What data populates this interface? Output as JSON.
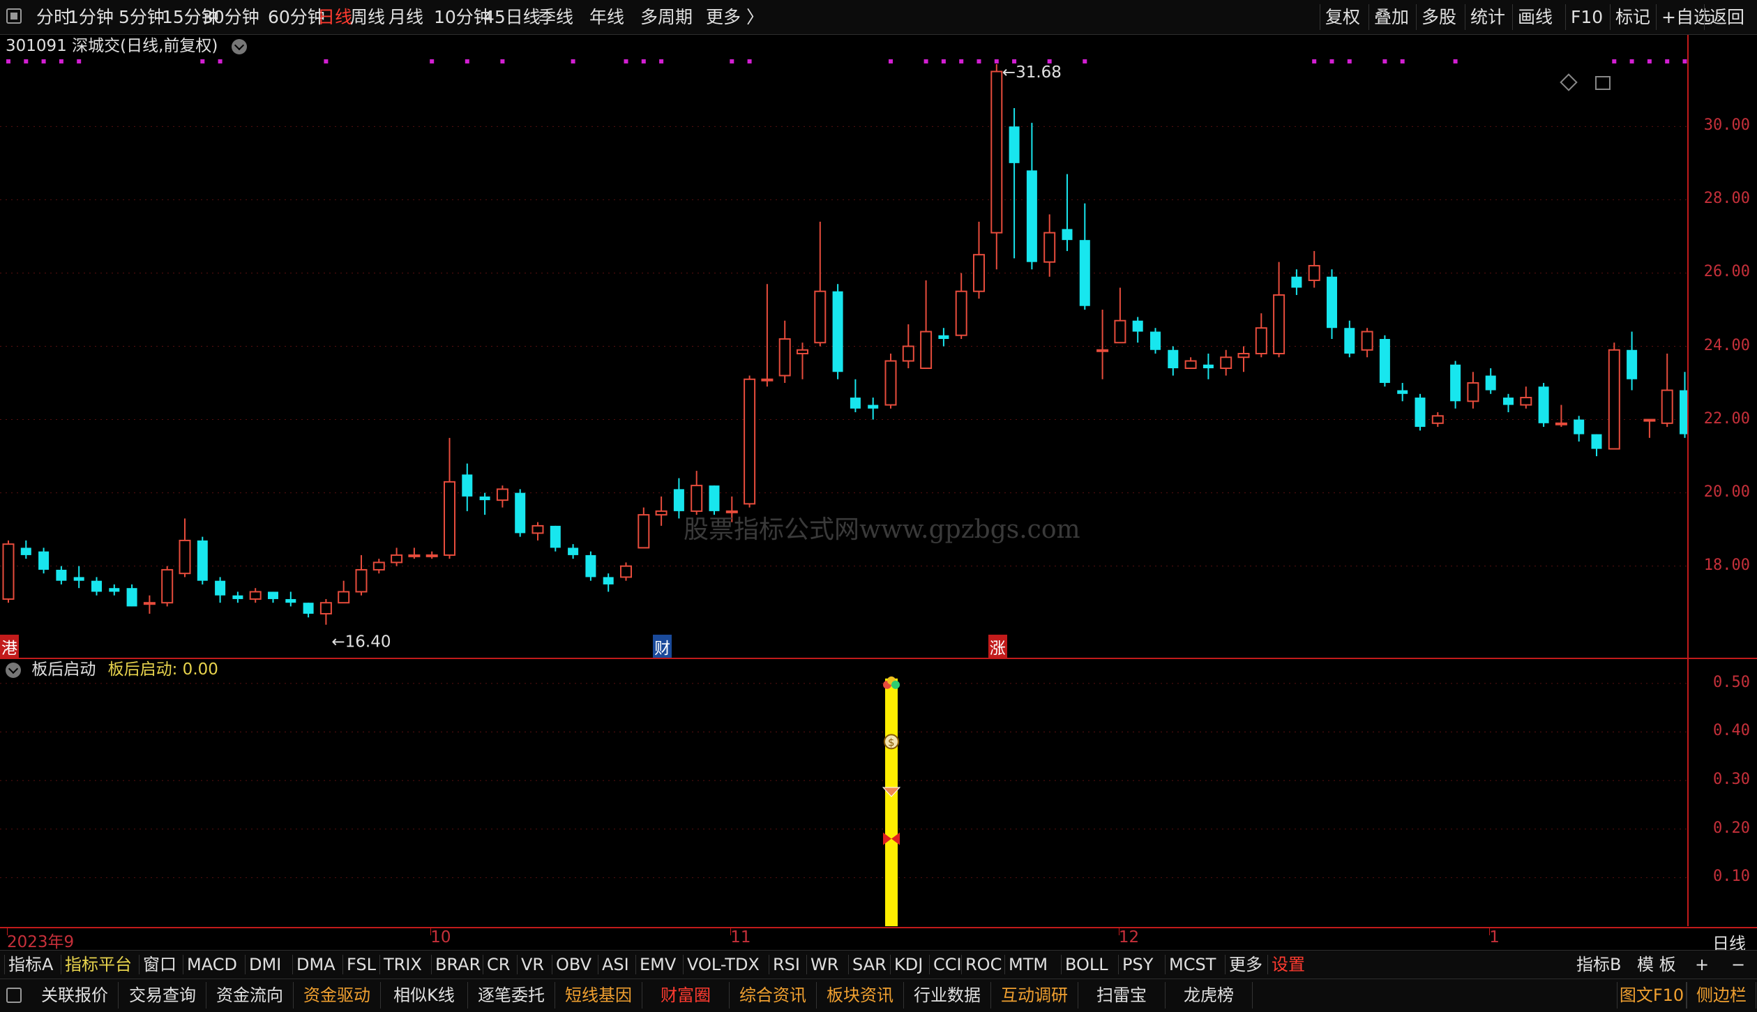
{
  "toolbar": {
    "periods": [
      {
        "label": "分时",
        "active": false
      },
      {
        "label": "1分钟",
        "active": false
      },
      {
        "label": "5分钟",
        "active": false
      },
      {
        "label": "15分钟",
        "active": false
      },
      {
        "label": "30分钟",
        "active": false
      },
      {
        "label": "60分钟",
        "active": false
      },
      {
        "label": "日线",
        "active": true
      },
      {
        "label": "周线",
        "active": false
      },
      {
        "label": "月线",
        "active": false
      },
      {
        "label": "10分钟",
        "active": false
      },
      {
        "label": "45日线",
        "active": false
      },
      {
        "label": "季线",
        "active": false
      },
      {
        "label": "年线",
        "active": false
      },
      {
        "label": "多周期",
        "active": false
      },
      {
        "label": "更多 〉",
        "active": false
      }
    ],
    "right_actions": [
      "复权",
      "叠加",
      "多股",
      "统计",
      "画线",
      "F10",
      "标记",
      "+自选",
      "返回"
    ]
  },
  "chart": {
    "title": "301091 深城交(日线,前复权)",
    "high_label": "31.68",
    "low_label": "16.40",
    "y_ticks": [
      "30.00",
      "28.00",
      "26.00",
      "24.00",
      "22.00",
      "20.00",
      "18.00"
    ],
    "markers": [
      {
        "text": "港",
        "color": "#c21b1b"
      },
      {
        "text": "财",
        "color": "#1a4a9a"
      },
      {
        "text": "涨",
        "color": "#c21b1b"
      }
    ],
    "watermark": "股票指标公式网www.gpzbgs.com",
    "colors": {
      "up": "#e74c3c",
      "down": "#18e6ee",
      "dots": "#d21fd2",
      "axis": "#c21b1b"
    }
  },
  "chart_data": {
    "type": "candlestick",
    "ylim": [
      15.5,
      32.5
    ],
    "candles": [
      [
        17.1,
        18.6,
        18.7,
        17.0
      ],
      [
        18.5,
        18.3,
        18.7,
        18.2
      ],
      [
        18.4,
        17.9,
        18.5,
        17.8
      ],
      [
        17.9,
        17.6,
        18.0,
        17.5
      ],
      [
        17.7,
        17.6,
        18.0,
        17.4
      ],
      [
        17.6,
        17.3,
        17.7,
        17.2
      ],
      [
        17.4,
        17.3,
        17.5,
        17.2
      ],
      [
        17.4,
        16.9,
        17.5,
        16.9
      ],
      [
        17.0,
        17.0,
        17.2,
        16.7
      ],
      [
        17.0,
        17.9,
        18.0,
        16.9
      ],
      [
        17.8,
        18.7,
        19.3,
        17.7
      ],
      [
        18.7,
        17.6,
        18.8,
        17.5
      ],
      [
        17.6,
        17.2,
        17.7,
        17.0
      ],
      [
        17.2,
        17.1,
        17.3,
        17.0
      ],
      [
        17.1,
        17.3,
        17.4,
        17.0
      ],
      [
        17.3,
        17.1,
        17.3,
        17.0
      ],
      [
        17.1,
        17.0,
        17.3,
        16.9
      ],
      [
        17.0,
        16.7,
        17.0,
        16.6
      ],
      [
        16.7,
        17.0,
        17.1,
        16.4
      ],
      [
        17.0,
        17.3,
        17.6,
        17.0
      ],
      [
        17.3,
        17.9,
        18.3,
        17.2
      ],
      [
        17.9,
        18.1,
        18.2,
        17.8
      ],
      [
        18.1,
        18.3,
        18.5,
        18.0
      ],
      [
        18.3,
        18.3,
        18.5,
        18.2
      ],
      [
        18.3,
        18.3,
        18.4,
        18.2
      ],
      [
        18.3,
        20.3,
        21.5,
        18.2
      ],
      [
        20.5,
        19.9,
        20.8,
        19.5
      ],
      [
        19.9,
        19.8,
        20.0,
        19.4
      ],
      [
        19.8,
        20.1,
        20.2,
        19.6
      ],
      [
        20.0,
        18.9,
        20.1,
        18.8
      ],
      [
        18.9,
        19.1,
        19.2,
        18.7
      ],
      [
        19.1,
        18.5,
        19.1,
        18.4
      ],
      [
        18.5,
        18.3,
        18.6,
        18.2
      ],
      [
        18.3,
        17.7,
        18.4,
        17.6
      ],
      [
        17.7,
        17.5,
        17.8,
        17.3
      ],
      [
        17.7,
        18.0,
        18.1,
        17.6
      ],
      [
        18.5,
        19.4,
        19.6,
        18.5
      ],
      [
        19.4,
        19.5,
        19.9,
        19.1
      ],
      [
        20.1,
        19.5,
        20.4,
        19.3
      ],
      [
        19.5,
        20.2,
        20.6,
        19.4
      ],
      [
        20.2,
        19.5,
        20.2,
        19.4
      ],
      [
        19.5,
        19.5,
        19.9,
        19.2
      ],
      [
        19.7,
        23.1,
        23.2,
        19.6
      ],
      [
        23.1,
        23.1,
        25.7,
        22.9
      ],
      [
        23.2,
        24.2,
        24.7,
        23.0
      ],
      [
        23.8,
        23.9,
        24.1,
        23.1
      ],
      [
        24.1,
        25.5,
        27.4,
        24.0
      ],
      [
        25.5,
        23.3,
        25.7,
        23.1
      ],
      [
        22.6,
        22.3,
        23.1,
        22.2
      ],
      [
        22.4,
        22.3,
        22.6,
        22.0
      ],
      [
        22.4,
        23.6,
        23.8,
        22.3
      ],
      [
        23.6,
        24.0,
        24.6,
        23.4
      ],
      [
        23.4,
        24.4,
        25.8,
        23.4
      ],
      [
        24.3,
        24.2,
        24.5,
        24.0
      ],
      [
        24.3,
        25.5,
        26.0,
        24.2
      ],
      [
        25.5,
        26.5,
        27.4,
        25.3
      ],
      [
        27.1,
        31.5,
        31.7,
        26.1
      ],
      [
        30.0,
        29.0,
        30.5,
        26.4
      ],
      [
        28.8,
        26.3,
        30.1,
        26.1
      ],
      [
        26.3,
        27.1,
        27.6,
        25.9
      ],
      [
        27.2,
        26.9,
        28.7,
        26.6
      ],
      [
        26.9,
        25.1,
        27.9,
        25.0
      ],
      [
        23.9,
        23.9,
        25.0,
        23.1
      ],
      [
        24.1,
        24.7,
        25.6,
        24.1
      ],
      [
        24.7,
        24.4,
        24.8,
        24.1
      ],
      [
        24.4,
        23.9,
        24.5,
        23.8
      ],
      [
        23.9,
        23.4,
        24.0,
        23.2
      ],
      [
        23.4,
        23.6,
        23.7,
        23.4
      ],
      [
        23.5,
        23.4,
        23.8,
        23.1
      ],
      [
        23.4,
        23.7,
        23.9,
        23.2
      ],
      [
        23.7,
        23.8,
        24.0,
        23.3
      ],
      [
        23.8,
        24.5,
        24.9,
        23.7
      ],
      [
        23.8,
        25.4,
        26.3,
        23.7
      ],
      [
        25.9,
        25.6,
        26.1,
        25.4
      ],
      [
        25.8,
        26.2,
        26.6,
        25.6
      ],
      [
        25.9,
        24.5,
        26.1,
        24.2
      ],
      [
        24.5,
        23.8,
        24.7,
        23.7
      ],
      [
        23.9,
        24.4,
        24.5,
        23.7
      ],
      [
        24.2,
        23.0,
        24.3,
        22.9
      ],
      [
        22.8,
        22.7,
        23.0,
        22.5
      ],
      [
        22.6,
        21.8,
        22.7,
        21.7
      ],
      [
        21.9,
        22.1,
        22.2,
        21.8
      ],
      [
        23.5,
        22.5,
        23.6,
        22.3
      ],
      [
        22.5,
        23.0,
        23.3,
        22.3
      ],
      [
        23.2,
        22.8,
        23.4,
        22.7
      ],
      [
        22.6,
        22.4,
        22.7,
        22.2
      ],
      [
        22.4,
        22.6,
        22.9,
        22.3
      ],
      [
        22.9,
        21.9,
        23.0,
        21.8
      ],
      [
        21.9,
        21.9,
        22.4,
        21.8
      ],
      [
        22.0,
        21.6,
        22.1,
        21.4
      ],
      [
        21.6,
        21.2,
        21.6,
        21.0
      ],
      [
        21.2,
        23.9,
        24.1,
        21.2
      ],
      [
        23.9,
        23.1,
        24.4,
        22.8
      ],
      [
        22.0,
        22.0,
        22.0,
        21.5
      ],
      [
        21.9,
        22.8,
        23.8,
        21.8
      ],
      [
        22.8,
        21.6,
        23.3,
        21.5
      ]
    ],
    "magenta_dots_x": [
      0,
      1,
      2,
      3,
      4,
      11,
      12,
      18,
      24,
      26,
      28,
      32,
      35,
      36,
      37,
      41,
      42,
      50,
      52,
      53,
      54,
      55,
      56,
      57,
      59,
      61,
      74,
      75,
      76,
      78,
      79,
      82,
      91,
      92,
      93,
      94,
      95
    ]
  },
  "subchart": {
    "title": "板后启动",
    "value_label": "板后启动: 0.00",
    "y_ticks": [
      "0.50",
      "0.40",
      "0.30",
      "0.20",
      "0.10"
    ],
    "bar_value": 0.51,
    "bar_x_index": 50,
    "bar_color": "#ffee00"
  },
  "x_axis": {
    "labels": [
      "2023年9",
      "10",
      "11",
      "12",
      "1"
    ],
    "label_x_index": [
      0,
      24,
      41,
      63,
      84
    ],
    "period": "日线"
  },
  "indicator_bar": {
    "items": [
      {
        "label": "指标A",
        "color": "#e0e0e0"
      },
      {
        "label": "指标平台",
        "color": "#e8d44d"
      },
      {
        "label": "窗口",
        "color": "#e0e0e0"
      },
      {
        "label": "MACD",
        "color": "#e0e0e0"
      },
      {
        "label": "DMI",
        "color": "#e0e0e0"
      },
      {
        "label": "DMA",
        "color": "#e0e0e0"
      },
      {
        "label": "FSL",
        "color": "#e0e0e0"
      },
      {
        "label": "TRIX",
        "color": "#e0e0e0"
      },
      {
        "label": "BRAR",
        "color": "#e0e0e0"
      },
      {
        "label": "CR",
        "color": "#e0e0e0"
      },
      {
        "label": "VR",
        "color": "#e0e0e0"
      },
      {
        "label": "OBV",
        "color": "#e0e0e0"
      },
      {
        "label": "ASI",
        "color": "#e0e0e0"
      },
      {
        "label": "EMV",
        "color": "#e0e0e0"
      },
      {
        "label": "VOL-TDX",
        "color": "#e0e0e0"
      },
      {
        "label": "RSI",
        "color": "#e0e0e0"
      },
      {
        "label": "WR",
        "color": "#e0e0e0"
      },
      {
        "label": "SAR",
        "color": "#e0e0e0"
      },
      {
        "label": "KDJ",
        "color": "#e0e0e0"
      },
      {
        "label": "CCI",
        "color": "#e0e0e0"
      },
      {
        "label": "ROC",
        "color": "#e0e0e0"
      },
      {
        "label": "MTM",
        "color": "#e0e0e0"
      },
      {
        "label": "BOLL",
        "color": "#e0e0e0"
      },
      {
        "label": "PSY",
        "color": "#e0e0e0"
      },
      {
        "label": "MCST",
        "color": "#e0e0e0"
      },
      {
        "label": "更多",
        "color": "#e0e0e0"
      },
      {
        "label": "设置",
        "color": "#ff3b30"
      }
    ],
    "right_items": [
      "指标B",
      "模 板",
      "+",
      "−"
    ]
  },
  "bottom_bar": {
    "items": [
      {
        "label": "关联报价",
        "color": "#e0e0e0"
      },
      {
        "label": "交易查询",
        "color": "#e0e0e0"
      },
      {
        "label": "资金流向",
        "color": "#e0e0e0"
      },
      {
        "label": "资金驱动",
        "color": "#f0a030"
      },
      {
        "label": "相似K线",
        "color": "#e0e0e0"
      },
      {
        "label": "逐笔委托",
        "color": "#e0e0e0"
      },
      {
        "label": "短线基因",
        "color": "#f0a030"
      },
      {
        "label": "财富圈",
        "color": "#ff3b30"
      },
      {
        "label": "综合资讯",
        "color": "#f0a030"
      },
      {
        "label": "板块资讯",
        "color": "#f0a030"
      },
      {
        "label": "行业数据",
        "color": "#e0e0e0"
      },
      {
        "label": "互动调研",
        "color": "#f0a030"
      },
      {
        "label": "扫雷宝",
        "color": "#e0e0e0"
      },
      {
        "label": "龙虎榜",
        "color": "#e0e0e0"
      }
    ],
    "right_items": [
      {
        "label": "图文F10",
        "color": "#f0a030"
      },
      {
        "label": "侧边栏",
        "color": "#f0a030"
      }
    ]
  }
}
